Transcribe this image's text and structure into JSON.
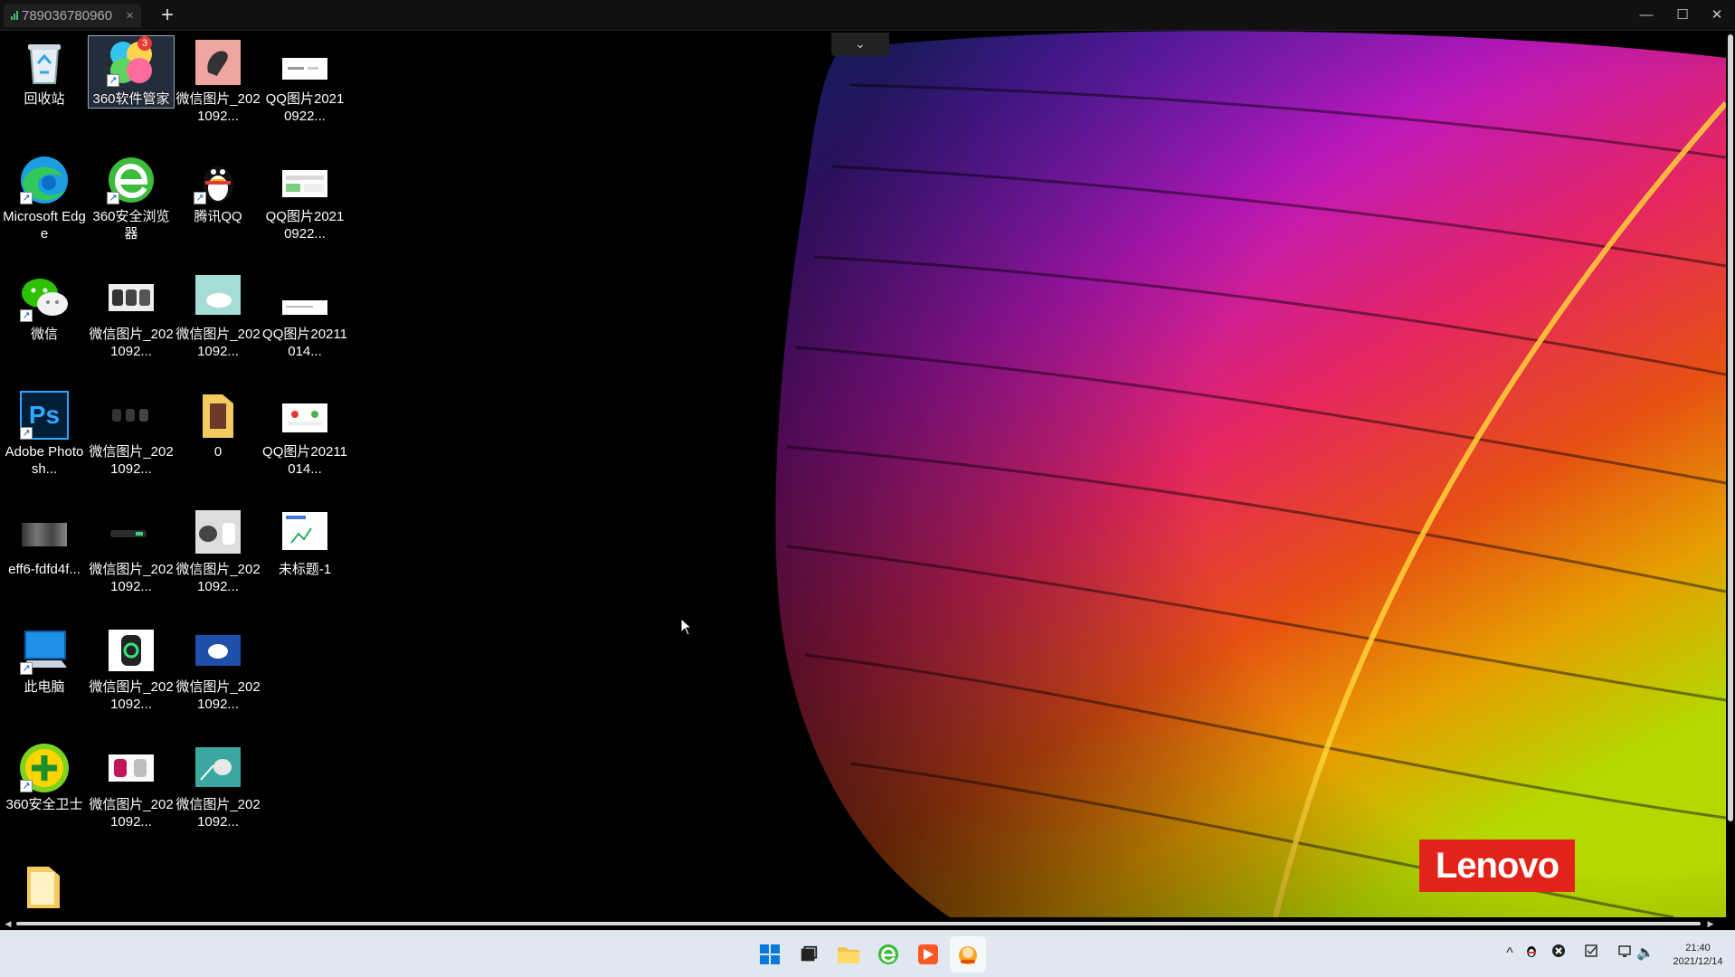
{
  "window": {
    "tab_title": "789036780960",
    "tab_close": "×",
    "new_tab": "+",
    "minimize": "—",
    "maximize": "☐",
    "close": "✕",
    "dropdown": "⌄"
  },
  "desktop": {
    "icons": [
      {
        "label": "回收站",
        "icon": "recycle-bin-icon"
      },
      {
        "label": "360软件管家",
        "icon": "360-software-manager-icon",
        "badge": "3"
      },
      {
        "label": "微信图片_2021092...",
        "icon": "image-thumbnail-icon"
      },
      {
        "label": "QQ图片20210922...",
        "icon": "image-thumbnail-icon"
      },
      {
        "label": "Microsoft Edge",
        "icon": "edge-icon"
      },
      {
        "label": "360安全浏览器",
        "icon": "360-browser-icon"
      },
      {
        "label": "腾讯QQ",
        "icon": "qq-penguin-icon"
      },
      {
        "label": "QQ图片20210922...",
        "icon": "image-thumbnail-icon"
      },
      {
        "label": "微信",
        "icon": "wechat-icon"
      },
      {
        "label": "微信图片_2021092...",
        "icon": "image-thumbnail-icon"
      },
      {
        "label": "微信图片_2021092...",
        "icon": "image-thumbnail-icon"
      },
      {
        "label": "QQ图片20211014...",
        "icon": "image-thumbnail-icon"
      },
      {
        "label": "Adobe Photosh...",
        "icon": "photoshop-icon",
        "glyph": "Ps"
      },
      {
        "label": "微信图片_2021092...",
        "icon": "image-thumbnail-icon"
      },
      {
        "label": "0",
        "icon": "folder-icon"
      },
      {
        "label": "QQ图片20211014...",
        "icon": "image-thumbnail-icon"
      },
      {
        "label": "eff6-fdfd4f...",
        "icon": "image-thumbnail-icon"
      },
      {
        "label": "微信图片_2021092...",
        "icon": "image-thumbnail-icon"
      },
      {
        "label": "微信图片_2021092...",
        "icon": "image-thumbnail-icon"
      },
      {
        "label": "未标题-1",
        "icon": "image-thumbnail-icon"
      },
      {
        "label": "此电脑",
        "icon": "this-pc-icon"
      },
      {
        "label": "微信图片_2021092...",
        "icon": "image-thumbnail-icon"
      },
      {
        "label": "微信图片_2021092...",
        "icon": "image-thumbnail-icon"
      },
      {
        "label": "360安全卫士",
        "icon": "360-security-icon"
      },
      {
        "label": "微信图片_2021092...",
        "icon": "image-thumbnail-icon"
      },
      {
        "label": "微信图片_2021092...",
        "icon": "image-thumbnail-icon"
      },
      {
        "label": "",
        "icon": "folder-icon"
      }
    ],
    "wallpaper_logo": "Lenovo"
  },
  "taskbar": {
    "apps": [
      "start-icon",
      "task-view-icon",
      "file-explorer-icon",
      "360-browser-icon",
      "remote-app-icon",
      "remote-desktop-icon"
    ],
    "tray": {
      "chevron": "^",
      "volume": "🔈"
    },
    "clock_time": "21:40",
    "clock_date": "2021/12/14"
  },
  "colors": {
    "accent": "#e2231a",
    "taskbar": "#dfe8f0"
  }
}
